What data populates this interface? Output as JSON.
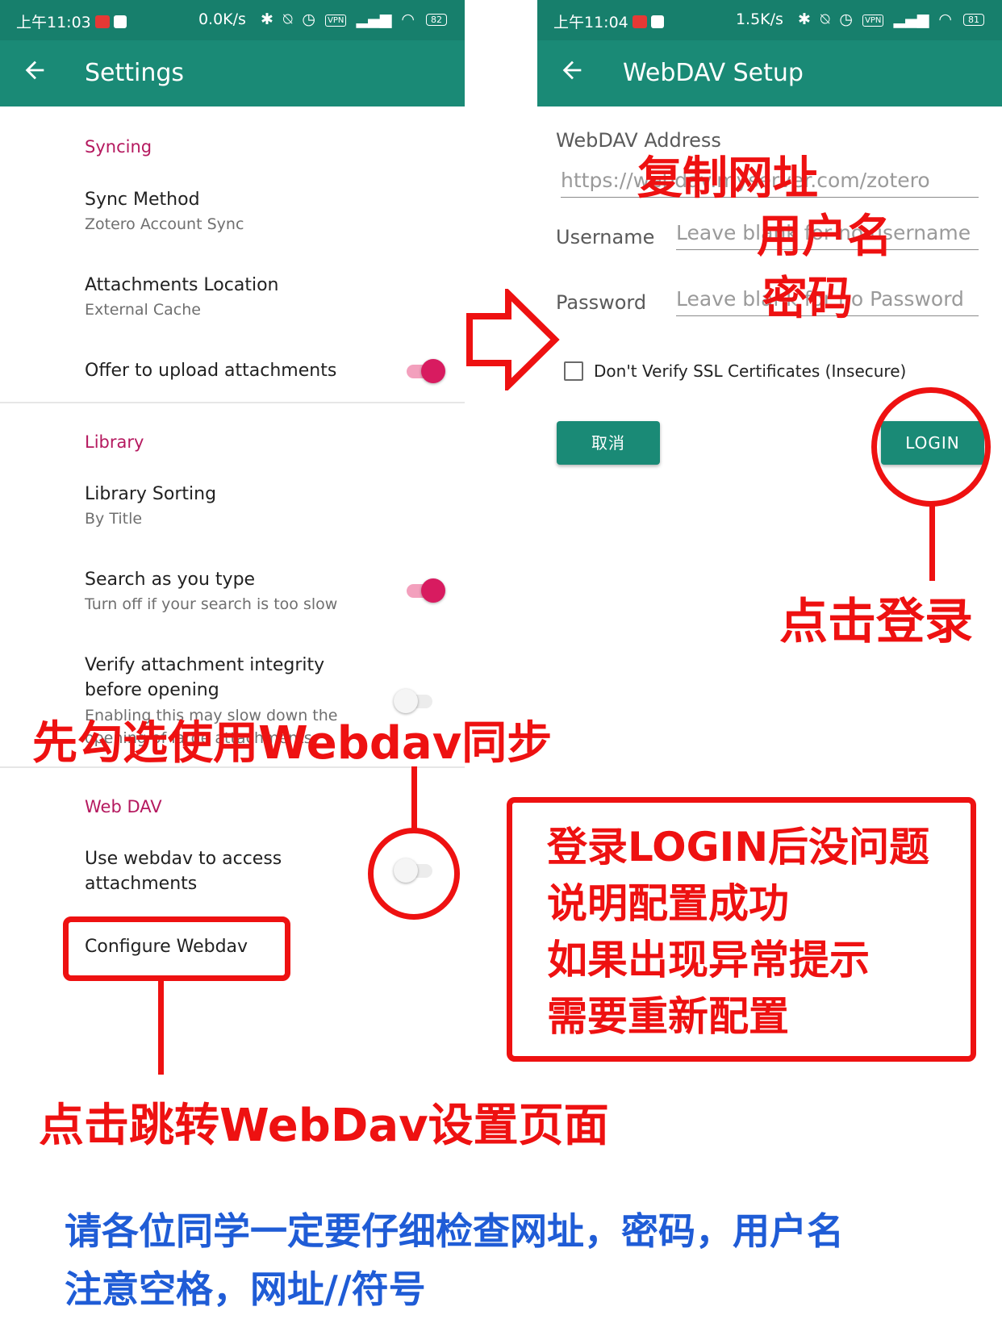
{
  "left": {
    "status": {
      "time": "上午11:03",
      "speed": "0.0K/s",
      "battery": "82",
      "vpn": "VPN"
    },
    "title": "Settings",
    "syncing": {
      "header": "Syncing",
      "sync_method_title": "Sync Method",
      "sync_method_value": "Zotero Account Sync",
      "attachments_location_title": "Attachments Location",
      "attachments_location_value": "External Cache",
      "offer_upload_title": "Offer to upload attachments",
      "offer_upload_on": true
    },
    "library": {
      "header": "Library",
      "sorting_title": "Library Sorting",
      "sorting_value": "By Title",
      "search_title": "Search as you type",
      "search_sub": "Turn off if your search is too slow",
      "search_on": true,
      "verify_title_1": "Verify attachment integrity",
      "verify_title_2": "before opening",
      "verify_sub_1": "Enabling this may slow down the",
      "verify_sub_2": "opening of large attachments",
      "verify_on": false
    },
    "webdav": {
      "header": "Web DAV",
      "use_title_1": "Use webdav to access",
      "use_title_2": "attachments",
      "use_on": false,
      "configure": "Configure Webdav"
    }
  },
  "right": {
    "status": {
      "time": "上午11:04",
      "speed": "1.5K/s",
      "battery": "81",
      "vpn": "VPN"
    },
    "title": "WebDAV Setup",
    "address_label": "WebDAV Address",
    "address_placeholder": "https://webdav.myserver.com/zotero",
    "username_label": "Username",
    "username_placeholder": "Leave blank for no username",
    "password_label": "Password",
    "password_placeholder": "Leave blank for no Password",
    "ssl_label": "Don't Verify SSL Certificates (Insecure)",
    "cancel": "取消",
    "login": "LOGIN"
  },
  "annotations": {
    "copy_url": "复制网址",
    "username": "用户名",
    "password": "密码",
    "click_login": "点击登录",
    "check_webdav": "先勾选使用Webdav同步",
    "note_1": "登录LOGIN后没问题",
    "note_2": "说明配置成功",
    "note_3": "如果出现异常提示",
    "note_4": "需要重新配置",
    "click_jump": "点击跳转WebDav设置页面",
    "reminder_1": "请各位同学一定要仔细检查网址，密码，用户名",
    "reminder_2": "注意空格，网址//符号"
  },
  "colors": {
    "teal": "#1a8a76",
    "teal_dark": "#177f6c",
    "accent_pink": "#d81b60",
    "category": "#b5195f",
    "annotation_red": "#ee1111",
    "annotation_blue": "#1f5cd6"
  },
  "icons": {
    "back": "arrow-left-icon",
    "bluetooth": "bluetooth-icon",
    "mute": "vibrate-icon",
    "alarm": "alarm-icon",
    "signal": "signal-icon",
    "wifi": "wifi-icon",
    "battery": "battery-icon"
  }
}
